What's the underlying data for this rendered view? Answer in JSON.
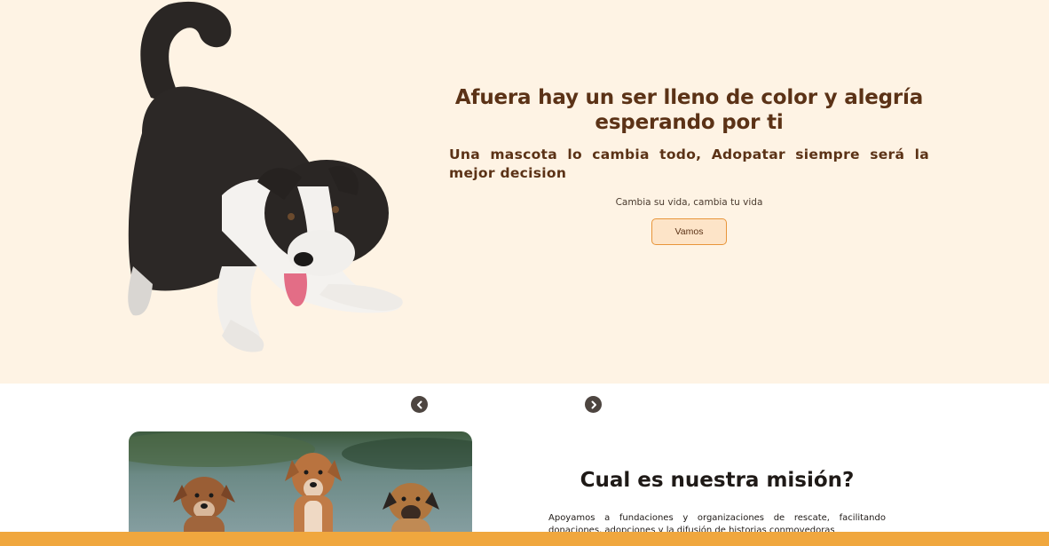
{
  "hero": {
    "title": "Afuera hay un ser lleno de color y alegría esperando por ti",
    "subtitle": "Una mascota lo cambia todo, Adopatar siempre será la mejor decision",
    "tagline": "Cambia su vida, cambia tu vida",
    "cta_label": "Vamos"
  },
  "carousel": {
    "prev_icon": "chevron-left-circle-icon",
    "next_icon": "chevron-right-circle-icon"
  },
  "mission": {
    "title": "Cual es nuestra misión?",
    "text": "Apoyamos a fundaciones y organizaciones de rescate, facilitando donaciones, adopciones y la difusión de historias conmovedoras"
  },
  "colors": {
    "hero_bg": "#fef3e4",
    "heading": "#5b3216",
    "accent": "#e8953a",
    "footer_bar": "#f0a73e"
  }
}
